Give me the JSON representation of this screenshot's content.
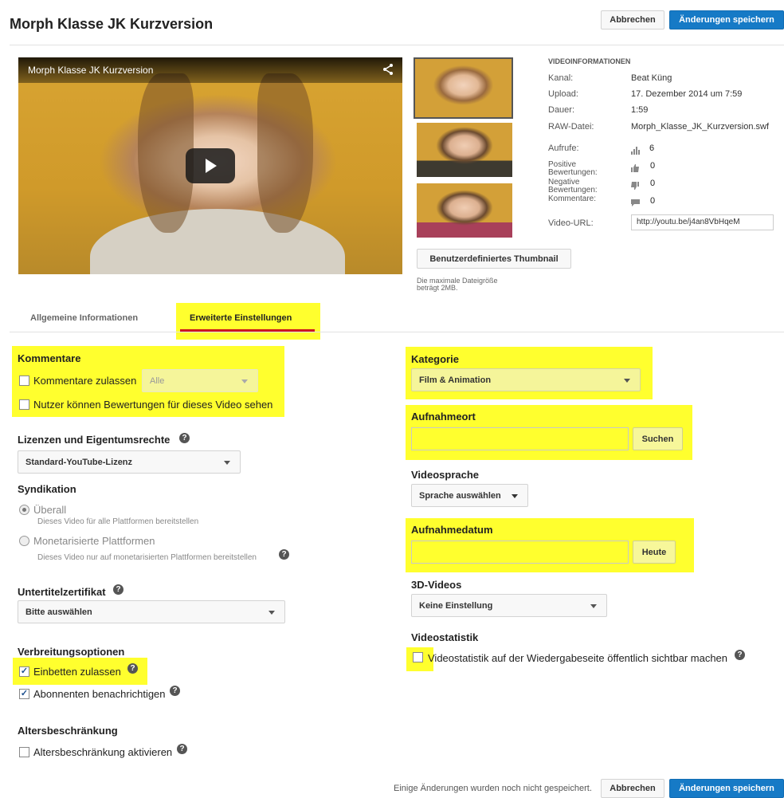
{
  "header": {
    "title": "Morph Klasse JK Kurzversion",
    "cancel_label": "Abbrechen",
    "save_label": "Änderungen speichern"
  },
  "player": {
    "title": "Morph Klasse JK Kurzversion"
  },
  "thumbnails": {
    "custom_button": "Benutzerdefiniertes Thumbnail",
    "note_line1": "Die maximale Dateigröße",
    "note_line2": "beträgt 2MB."
  },
  "video_info": {
    "heading": "VIDEOINFORMATIONEN",
    "channel_label": "Kanal:",
    "channel_value": "Beat Küng",
    "upload_label": "Upload:",
    "upload_value": "17. Dezember 2014 um 7:59",
    "duration_label": "Dauer:",
    "duration_value": "1:59",
    "raw_label": "RAW-Datei:",
    "raw_value": "Morph_Klasse_JK_Kurzversion.swf",
    "views_label": "Aufrufe:",
    "views_value": "6",
    "likes_label_1": "Positive",
    "likes_label_2": "Bewertungen:",
    "likes_value": "0",
    "dislikes_label_1": "Negative",
    "dislikes_label_2": "Bewertungen:",
    "dislikes_value": "0",
    "comments_label": "Kommentare:",
    "comments_value": "0",
    "url_label": "Video-URL:",
    "url_value": "http://youtu.be/j4an8VbHqeM"
  },
  "tabs": {
    "general": "Allgemeine Informationen",
    "advanced": "Erweiterte Einstellungen"
  },
  "left": {
    "comments_heading": "Kommentare",
    "allow_comments": "Kommentare zulassen",
    "comments_select": "Alle",
    "ratings_visible": "Nutzer können Bewertungen für dieses Video sehen",
    "license_heading": "Lizenzen und Eigentumsrechte",
    "license_select": "Standard-YouTube-Lizenz",
    "syndication_heading": "Syndikation",
    "everywhere_label": "Überall",
    "everywhere_desc": "Dieses Video für alle Plattformen bereitstellen",
    "monetized_label": "Monetarisierte Plattformen",
    "monetized_desc": "Dieses Video nur auf monetarisierten Plattformen bereitstellen",
    "caption_heading": "Untertitelzertifikat",
    "caption_select": "Bitte auswählen",
    "distribution_heading": "Verbreitungsoptionen",
    "embed_label": "Einbetten zulassen",
    "notify_label": "Abonnenten benachrichtigen",
    "age_heading": "Altersbeschränkung",
    "age_label": "Altersbeschränkung aktivieren"
  },
  "right": {
    "category_heading": "Kategorie",
    "category_select": "Film & Animation",
    "location_heading": "Aufnahmeort",
    "search_button": "Suchen",
    "language_heading": "Videosprache",
    "language_select": "Sprache auswählen",
    "date_heading": "Aufnahmedatum",
    "today_button": "Heute",
    "threed_heading": "3D-Videos",
    "threed_select": "Keine Einstellung",
    "stats_heading": "Videostatistik",
    "stats_label": "Videostatistik auf der Wiedergabeseite öffentlich sichtbar machen"
  },
  "footer": {
    "unsaved_note": "Einige Änderungen wurden noch nicht gespeichert.",
    "cancel_label": "Abbrechen",
    "save_label": "Änderungen speichern"
  },
  "colors": {
    "highlight": "#ffff2e",
    "accent_blue": "#167ac6",
    "tab_underline": "#cc181e"
  }
}
